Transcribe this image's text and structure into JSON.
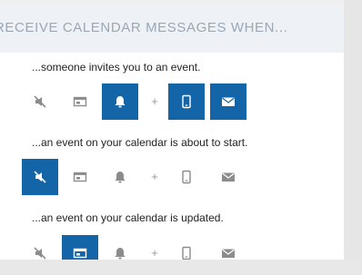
{
  "header": {
    "title": "RECEIVE CALENDAR MESSAGES WHEN..."
  },
  "sections": [
    {
      "label": "...someone invites you to an event.",
      "options": {
        "none": false,
        "summary": false,
        "reminder": true,
        "mobile": true,
        "email": true
      }
    },
    {
      "label": "...an event on your calendar is about to start.",
      "options": {
        "none": true,
        "summary": false,
        "reminder": false,
        "mobile": false,
        "email": false
      }
    },
    {
      "label": "...an event on your calendar is updated.",
      "options": {
        "none": false,
        "summary": true,
        "reminder": false,
        "mobile": false,
        "email": false
      }
    }
  ],
  "plus_symbol": "+",
  "colors": {
    "accent": "#1464a8",
    "icon_inactive": "#8c8c8c",
    "icon_active": "#ffffff",
    "header_bg": "#eef2f7"
  }
}
